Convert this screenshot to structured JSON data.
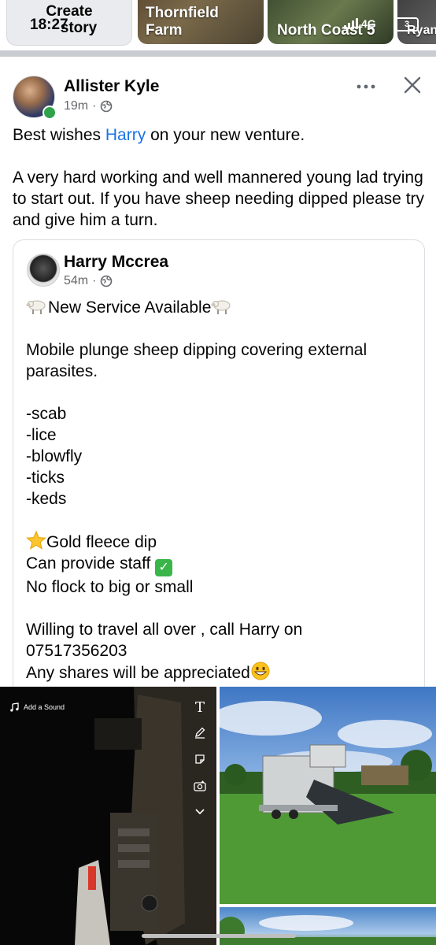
{
  "status_bar": {
    "time": "18:27",
    "network": "4G",
    "battery": "3"
  },
  "stories": {
    "create_line1": "Create",
    "create_line2": "story",
    "items": [
      {
        "label_line1": "Thornfield",
        "label_line2": "Farm"
      },
      {
        "label_line1": "North Coast 5"
      },
      {
        "label_line1": "Ryan"
      }
    ]
  },
  "post": {
    "author": "Allister Kyle",
    "time": "19m",
    "text_before_mention": "Best wishes ",
    "mention": "Harry",
    "text_after_mention": " on your new venture.",
    "paragraph_2": "A very hard working and well mannered young lad trying to start out. If you have sheep needing dipped please try and give him a turn.",
    "more_icon": "more-horizontal-icon",
    "close_icon": "close-icon"
  },
  "shared_post": {
    "author": "Harry Mccrea",
    "time": "54m",
    "lines": {
      "service": "New Service Available",
      "desc": "Mobile plunge sheep dipping covering external parasites.",
      "item1": "-scab",
      "item2": "-lice",
      "item3": "-blowfly",
      "item4": "-ticks",
      "item5": "-keds",
      "gold": "Gold fleece dip",
      "staff": "Can provide staff",
      "flock": "No flock to big or small",
      "travel": "Willing to travel all over , call Harry on",
      "phone": "07517356203",
      "shares": "Any shares will be appreciated"
    }
  },
  "photo_left": {
    "sound_label": "Add a Sound",
    "tool_text": "T"
  }
}
